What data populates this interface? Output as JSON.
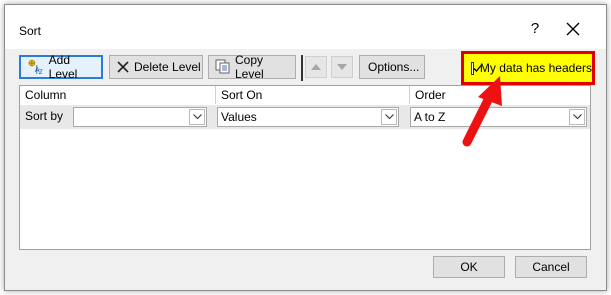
{
  "window": {
    "title": "Sort",
    "help_glyph": "?"
  },
  "toolbar": {
    "add_level": "Add Level",
    "delete_level": "Delete Level",
    "copy_level": "Copy Level",
    "options": "Options...",
    "my_data_has_headers": "My data has headers",
    "my_data_has_headers_checked": true
  },
  "grid": {
    "columns": [
      "Column",
      "Sort On",
      "Order"
    ],
    "rows": [
      {
        "label": "Sort by",
        "column": "",
        "sort_on": "Values",
        "order": "A to Z"
      }
    ]
  },
  "footer": {
    "ok": "OK",
    "cancel": "Cancel"
  },
  "colors": {
    "highlight_fill": "#ffff00",
    "highlight_border": "#e00000",
    "annotation_arrow": "#ee1111",
    "focus_border": "#2b7bd8"
  },
  "icons": [
    "add-level-icon",
    "delete-x-icon",
    "copy-level-icon",
    "move-up-icon",
    "move-down-icon",
    "close-icon",
    "dropdown-chevron-icon",
    "checkmark-icon"
  ]
}
